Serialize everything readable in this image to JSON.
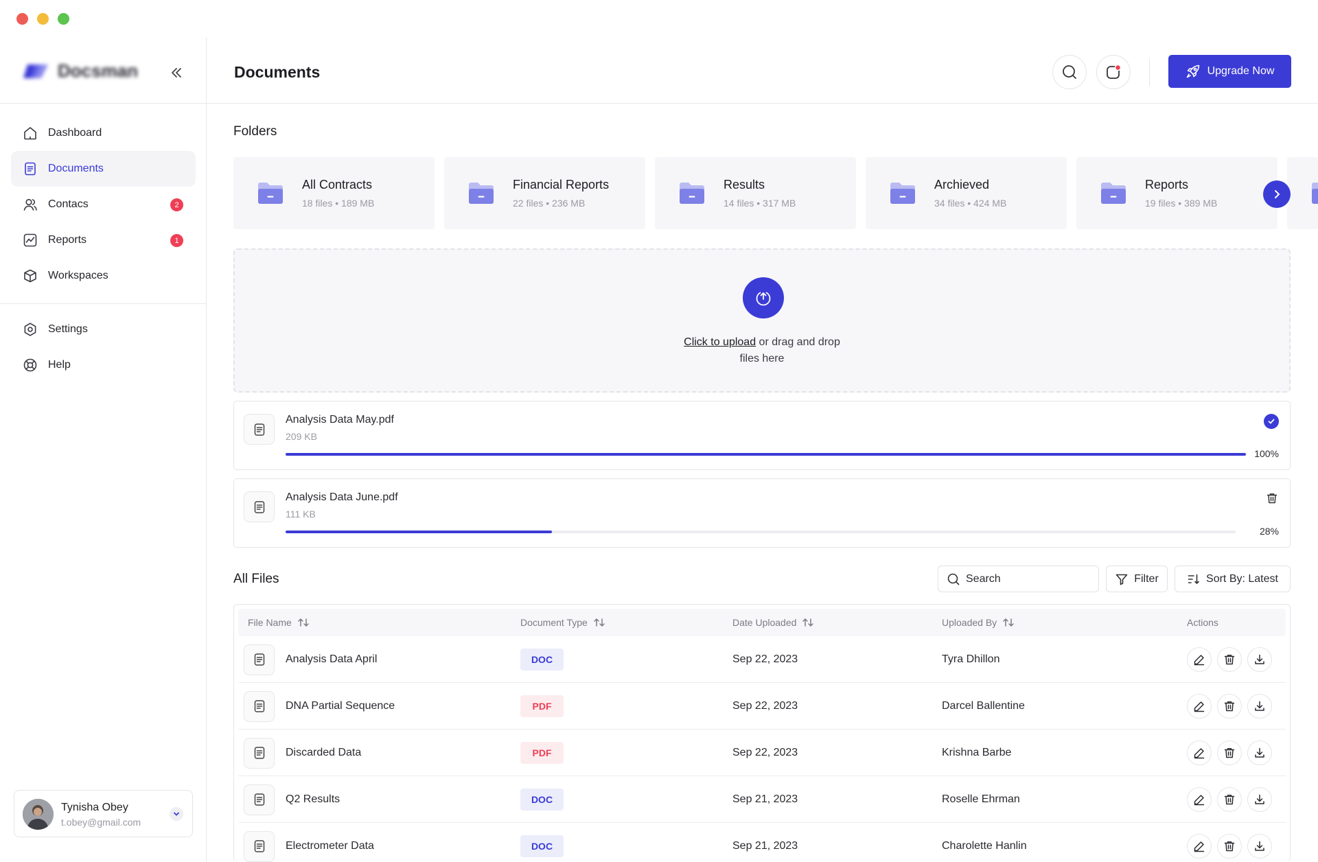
{
  "app": {
    "name": "Docsman"
  },
  "sidebar": {
    "main_items": [
      {
        "label": "Dashboard",
        "icon": "home-icon"
      },
      {
        "label": "Documents",
        "icon": "document-icon",
        "active": true
      },
      {
        "label": "Contacs",
        "icon": "users-icon",
        "badge": "2"
      },
      {
        "label": "Reports",
        "icon": "chart-icon",
        "badge": "1"
      },
      {
        "label": "Workspaces",
        "icon": "cube-icon"
      }
    ],
    "secondary_items": [
      {
        "label": "Settings",
        "icon": "gear-icon"
      },
      {
        "label": "Help",
        "icon": "lifebuoy-icon"
      }
    ],
    "user": {
      "name": "Tynisha Obey",
      "email": "t.obey@gmail.com"
    }
  },
  "header": {
    "title": "Documents",
    "upgrade_label": "Upgrade Now"
  },
  "folders": {
    "title": "Folders",
    "items": [
      {
        "name": "All Contracts",
        "meta": "18 files • 189 MB"
      },
      {
        "name": "Financial Reports",
        "meta": "22 files • 236 MB"
      },
      {
        "name": "Results",
        "meta": "14 files • 317 MB"
      },
      {
        "name": "Archieved",
        "meta": "34 files • 424 MB"
      },
      {
        "name": "Reports",
        "meta": "19 files • 389 MB"
      }
    ]
  },
  "upload": {
    "link_text": "Click to upload",
    "rest_text": " or drag and drop",
    "second_line": "files here",
    "items": [
      {
        "name": "Analysis Data May.pdf",
        "size": "209 KB",
        "progress": 100,
        "percent_label": "100%",
        "status": "complete"
      },
      {
        "name": "Analysis Data June.pdf",
        "size": "111 KB",
        "progress": 28,
        "percent_label": "28%",
        "status": "uploading"
      }
    ]
  },
  "files": {
    "title": "All Files",
    "search_placeholder": "Search",
    "filter_label": "Filter",
    "sort_label": "Sort By: Latest",
    "columns": [
      "File Name",
      "Document Type",
      "Date Uploaded",
      "Uploaded By",
      "Actions"
    ],
    "rows": [
      {
        "name": "Analysis Data April",
        "type": "DOC",
        "date": "Sep 22, 2023",
        "by": "Tyra Dhillon"
      },
      {
        "name": "DNA Partial Sequence",
        "type": "PDF",
        "date": "Sep 22, 2023",
        "by": "Darcel Ballentine"
      },
      {
        "name": "Discarded Data",
        "type": "PDF",
        "date": "Sep 22, 2023",
        "by": "Krishna Barbe"
      },
      {
        "name": "Q2 Results",
        "type": "DOC",
        "date": "Sep 21, 2023",
        "by": "Roselle Ehrman"
      },
      {
        "name": "Electrometer Data",
        "type": "DOC",
        "date": "Sep 21, 2023",
        "by": "Charolette Hanlin"
      }
    ]
  },
  "colors": {
    "accent": "#3b3bd6",
    "danger": "#ee3f56",
    "folder": "#8c8fe8"
  }
}
